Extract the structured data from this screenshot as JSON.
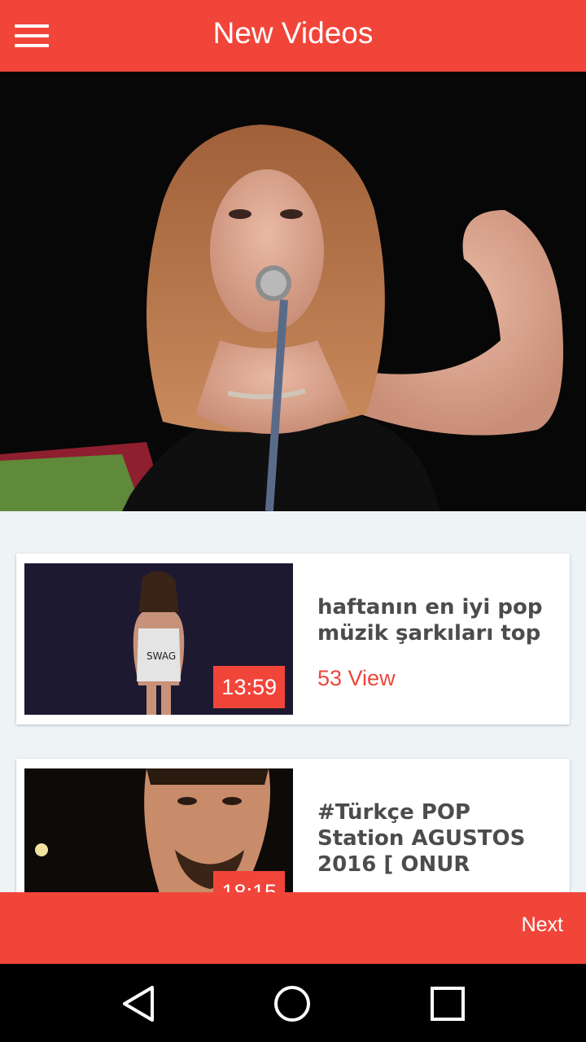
{
  "appbar": {
    "title": "New Videos",
    "menu_icon": "hamburger-icon",
    "color": "#f1453a"
  },
  "hero": {
    "image": "female singer at microphone on stage"
  },
  "videos": [
    {
      "title": "haftanın en iyi pop müzik şarkıları top",
      "duration": "13:59",
      "views": "53 View"
    },
    {
      "title": "#Türkçe POP Station AGUSTOS 2016 [ ONUR",
      "duration": "18:15",
      "views": ""
    }
  ],
  "footer": {
    "next_label": "Next"
  },
  "system_nav": {
    "back_icon": "back-triangle-icon",
    "home_icon": "home-circle-icon",
    "recents_icon": "recents-square-icon"
  }
}
